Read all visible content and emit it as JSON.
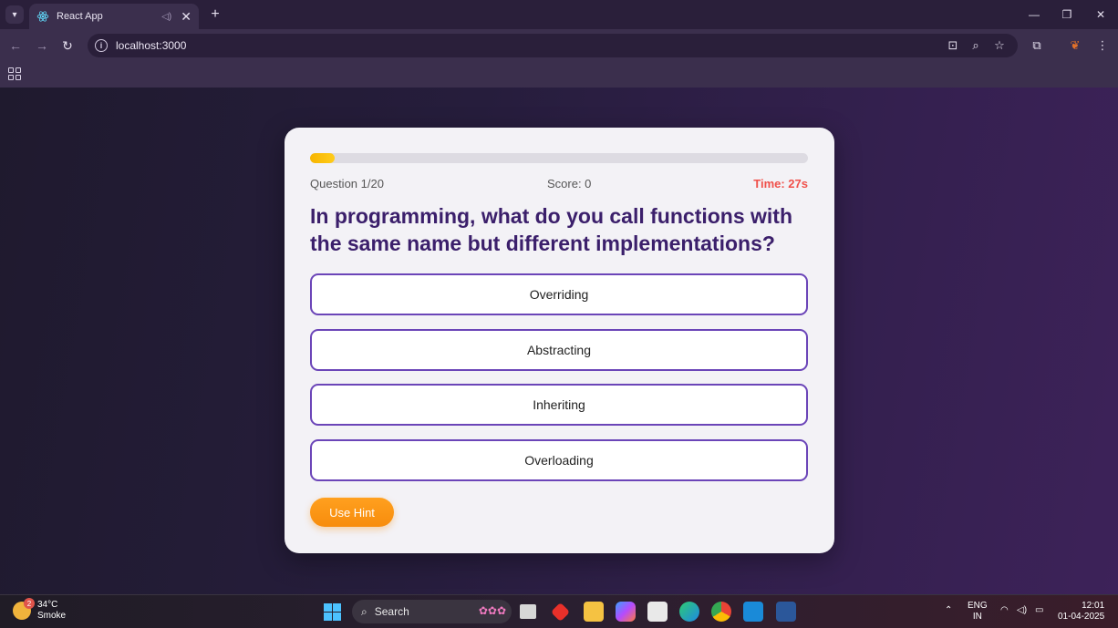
{
  "browser": {
    "tab_title": "React App",
    "url": "localhost:3000"
  },
  "quiz": {
    "progress_fraction": 0.05,
    "question_counter": "Question 1/20",
    "score": "Score: 0",
    "time": "Time: 27s",
    "question": "In programming, what do you call functions with the same name but different implementations?",
    "options": [
      "Overriding",
      "Abstracting",
      "Inheriting",
      "Overloading"
    ],
    "hint_label": "Use Hint"
  },
  "taskbar": {
    "weather_temp": "34°C",
    "weather_desc": "Smoke",
    "weather_badge": "2",
    "search_label": "Search",
    "language_line1": "ENG",
    "language_line2": "IN",
    "time": "12:01",
    "date": "01-04-2025"
  },
  "colors": {
    "accent": "#6b45b8",
    "question_text": "#3b1f6b",
    "timer": "#f0504a",
    "hint_button": "#ffa01f",
    "progress": "#f7b500"
  }
}
